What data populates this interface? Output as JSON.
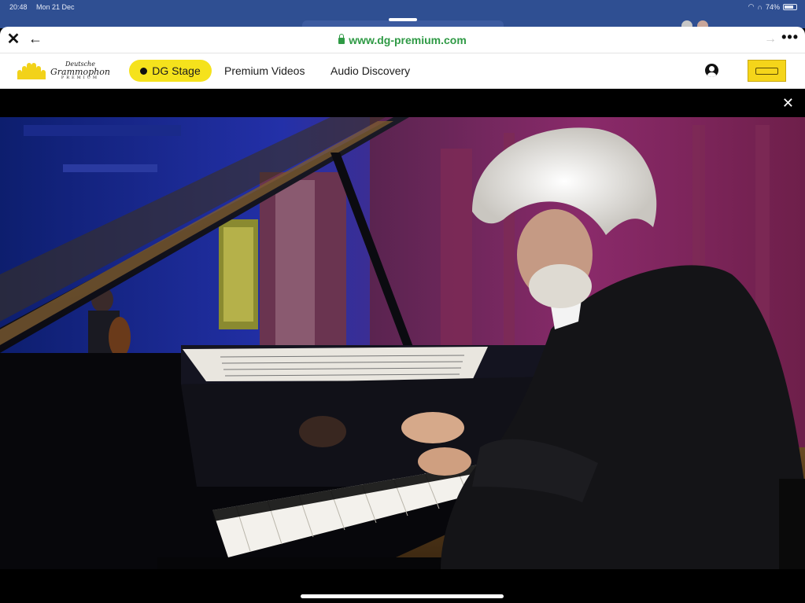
{
  "status_bar": {
    "time": "20:48",
    "date": "Mon 21 Dec",
    "battery": "74%"
  },
  "browser": {
    "domain": "www.dg-premium.com",
    "more_label": "•••"
  },
  "site": {
    "brand": {
      "line1": "Deutsche",
      "line2": "Grammophon",
      "line3": "PREMIUM"
    },
    "nav": {
      "stage": "DG Stage",
      "videos": "Premium Videos",
      "audio": "Audio Discovery"
    }
  },
  "colors": {
    "status_bar": "#2f4f92",
    "domain_green": "#2f9a45",
    "dg_yellow": "#f5e21c"
  },
  "icons": [
    "close-icon",
    "back-arrow-icon",
    "lock-icon",
    "forward-arrow-icon",
    "more-icon",
    "profile-icon",
    "video-close-icon"
  ]
}
